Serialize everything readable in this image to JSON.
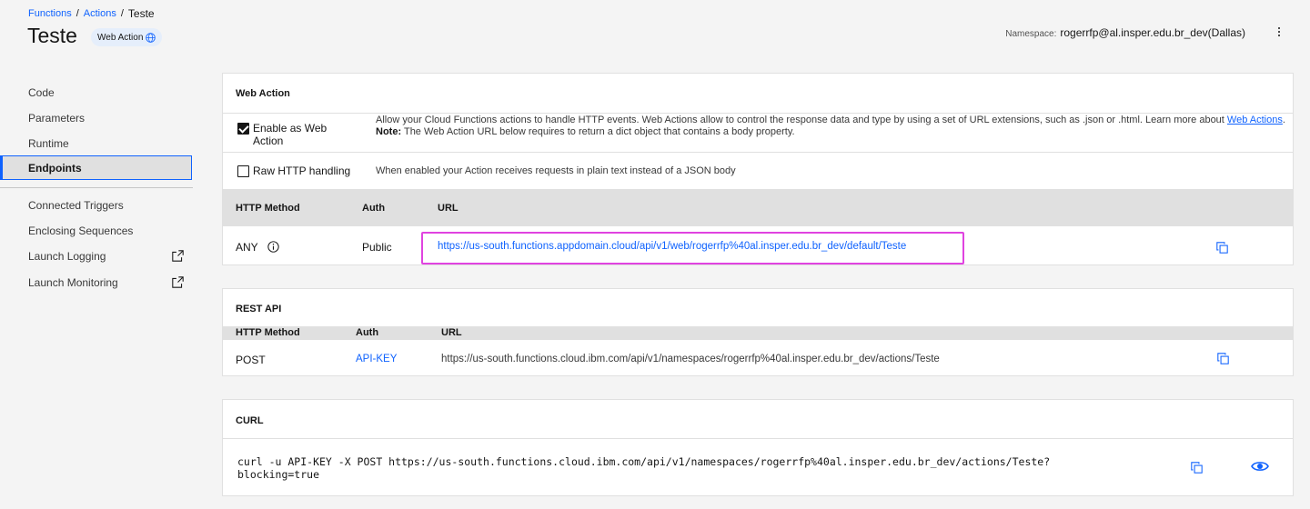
{
  "breadcrumb": {
    "items": [
      "Functions",
      "Actions"
    ],
    "separator": "/",
    "current": "Teste"
  },
  "page": {
    "title": "Teste",
    "tag_label": "Web Action"
  },
  "namespace": {
    "label": "Namespace:",
    "value": "rogerrfp@al.insper.edu.br_dev(Dallas)"
  },
  "sidenav": {
    "items": [
      "Code",
      "Parameters",
      "Runtime",
      "Endpoints"
    ],
    "active": "Endpoints",
    "secondary": [
      "Connected Triggers",
      "Enclosing Sequences",
      "Launch Logging",
      "Launch Monitoring"
    ]
  },
  "web_action": {
    "title": "Web Action",
    "enable": {
      "label": "Enable as Web Action",
      "checked": true,
      "desc_prefix": "Allow your Cloud Functions actions to handle HTTP events. Web Actions allow to control the response data and type by using a set of URL extensions, such as .json or .html. Learn more about",
      "desc_link": "Web Actions",
      "desc_suffix": ".",
      "note_label": "Note:",
      "note_text": "The Web Action URL below requires to return a dict object that contains a body property."
    },
    "raw": {
      "label": "Raw HTTP handling",
      "checked": false,
      "desc": "When enabled your Action receives requests in plain text instead of a JSON body"
    },
    "table": {
      "headers": [
        "HTTP Method",
        "Auth",
        "URL"
      ],
      "row": {
        "method": "ANY",
        "auth": "Public",
        "url": "https://us-south.functions.appdomain.cloud/api/v1/web/rogerrfp%40al.insper.edu.br_dev/default/Teste"
      }
    }
  },
  "rest_api": {
    "title": "REST API",
    "headers": [
      "HTTP Method",
      "Auth",
      "URL"
    ],
    "row": {
      "method": "POST",
      "auth": "API-KEY",
      "url": "https://us-south.functions.cloud.ibm.com/api/v1/namespaces/rogerrfp%40al.insper.edu.br_dev/actions/Teste"
    }
  },
  "curl": {
    "title": "CURL",
    "line1": "curl -u API-KEY -X POST https://us-south.functions.cloud.ibm.com/api/v1/namespaces/rogerrfp%40al.insper.edu.br_dev/actions/Teste?",
    "line2": "blocking=true"
  },
  "colors": {
    "accent": "#0f62fe",
    "highlight": "#e043e0",
    "nav_active_bg": "#e0e0e0",
    "table_header_bg": "#e0e0e0"
  },
  "icons": [
    "globe-icon",
    "overflow-menu-icon",
    "launch-icon",
    "info-icon",
    "copy-icon",
    "eye-icon",
    "checkmark-icon"
  ]
}
